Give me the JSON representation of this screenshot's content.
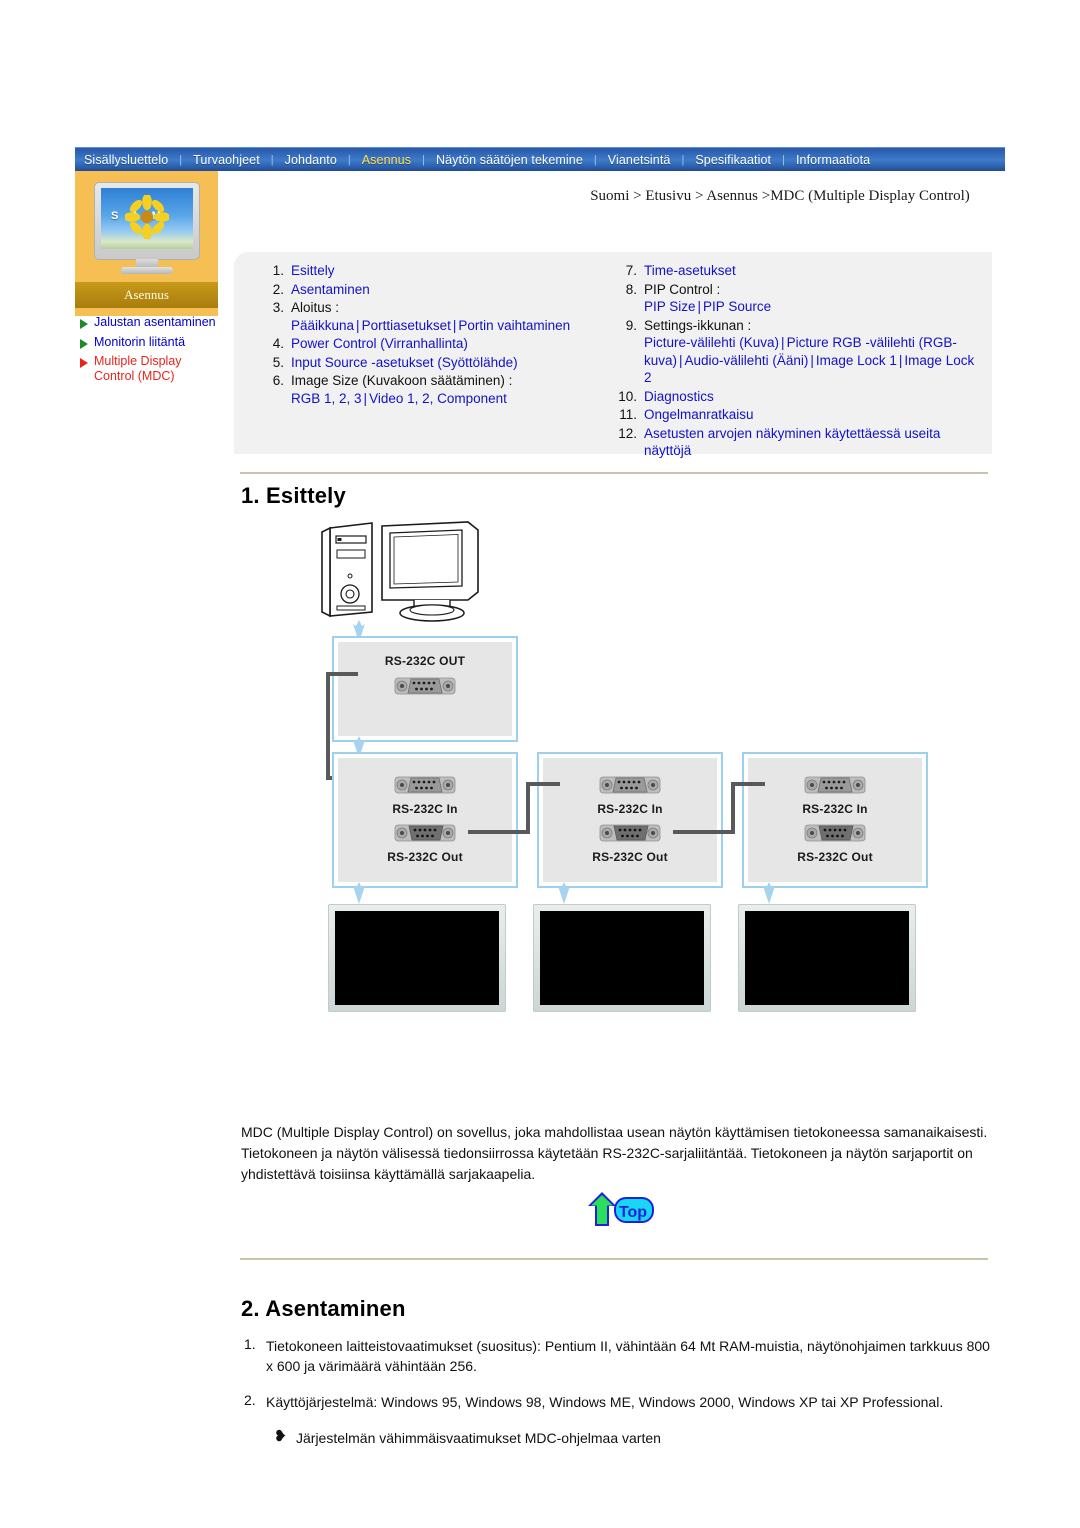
{
  "nav": {
    "items": [
      {
        "label": "Sisällysluettelo",
        "active": false
      },
      {
        "label": "Turvaohjeet",
        "active": false
      },
      {
        "label": "Johdanto",
        "active": false
      },
      {
        "label": "Asennus",
        "active": true
      },
      {
        "label": "Näytön säätöjen tekemine",
        "active": false
      },
      {
        "label": "Vianetsintä",
        "active": false
      },
      {
        "label": "Spesifikaatiot",
        "active": false
      },
      {
        "label": "Informaatiota",
        "active": false
      }
    ],
    "separator": "|",
    "active_color": "#ffe14d"
  },
  "sidebar": {
    "thumb_caption": "Asennus",
    "thumb_brand": "S A M",
    "links": [
      {
        "label": "Jalustan asentaminen",
        "active": false,
        "color": "#0000d0"
      },
      {
        "label": "Monitorin liitäntä",
        "active": false,
        "color": "#0000d0"
      },
      {
        "label": "Multiple Display Control (MDC)",
        "active": true,
        "color": "#e8251b"
      }
    ]
  },
  "breadcrumb": "Suomi > Etusivu > Asennus >MDC (Multiple Display Control)",
  "toc": {
    "left": [
      {
        "num": "1.",
        "title": "Esittely",
        "title_link": true
      },
      {
        "num": "2.",
        "title": "Asentaminen",
        "title_link": true
      },
      {
        "num": "3.",
        "title": "Aloitus :",
        "title_link": false,
        "sub": [
          "Pääikkuna",
          "Porttiasetukset",
          "Portin vaihtaminen"
        ]
      },
      {
        "num": "4.",
        "title": "Power Control (Virranhallinta)",
        "title_link": true
      },
      {
        "num": "5.",
        "title": "Input Source -asetukset (Syöttölähde)",
        "title_link": true
      },
      {
        "num": "6.",
        "title": "Image Size (Kuvakoon säätäminen) :",
        "title_link": false,
        "sub": [
          "RGB 1, 2, 3",
          "Video 1, 2, Component"
        ]
      }
    ],
    "right": [
      {
        "num": "7.",
        "title": "Time-asetukset",
        "title_link": true
      },
      {
        "num": "8.",
        "title": "PIP Control :",
        "title_link": false,
        "sub": [
          "PIP Size",
          "PIP Source"
        ]
      },
      {
        "num": "9.",
        "title": "Settings-ikkunan :",
        "title_link": false,
        "sub": [
          "Picture-välilehti (Kuva)",
          "Picture RGB -välilehti (RGB-kuva)",
          "Audio-välilehti (Ääni)",
          "Image Lock 1",
          "Image Lock 2"
        ]
      },
      {
        "num": "10.",
        "title": "Diagnostics",
        "title_link": true
      },
      {
        "num": "11.",
        "title": "Ongelmanratkaisu",
        "title_link": true
      },
      {
        "num": "12.",
        "title": "Asetusten arvojen näkyminen käytettäessä useita näyttöjä",
        "title_link": true
      }
    ]
  },
  "section1": {
    "heading": "1. Esittely",
    "diagram": {
      "pc_label": "",
      "out_box_label": "RS-232C OUT",
      "monitor_boxes": [
        {
          "in_label": "RS-232C In",
          "out_label": "RS-232C Out"
        },
        {
          "in_label": "RS-232C In",
          "out_label": "RS-232C Out"
        },
        {
          "in_label": "RS-232C In",
          "out_label": "RS-232C Out"
        }
      ]
    },
    "paragraph": "MDC (Multiple Display Control) on sovellus, joka mahdollistaa usean näytön käyttämisen tietokoneessa samanaikaisesti. Tietokoneen ja näytön välisessä tiedonsiirrossa käytetään RS-232C-sarjaliitäntää. Tietokoneen ja näytön sarjaportit on yhdistettävä toisiinsa käyttämällä sarjakaapelia.",
    "top_button_label": "Top"
  },
  "section2": {
    "heading": "2. Asentaminen",
    "items": [
      {
        "num": "1.",
        "text": "Tietokoneen laitteistovaatimukset (suositus): Pentium II, vähintään 64 Mt RAM-muistia, näytönohjaimen tarkkuus 800 x 600 ja värimäärä vähintään 256."
      },
      {
        "num": "2.",
        "text": "Käyttöjärjestelmä: Windows 95, Windows 98, Windows ME, Windows 2000, Windows XP tai XP Professional."
      }
    ],
    "note": "Järjestelmän vähimmäisvaatimukset MDC-ohjelmaa varten",
    "note_glyph": "❥"
  }
}
